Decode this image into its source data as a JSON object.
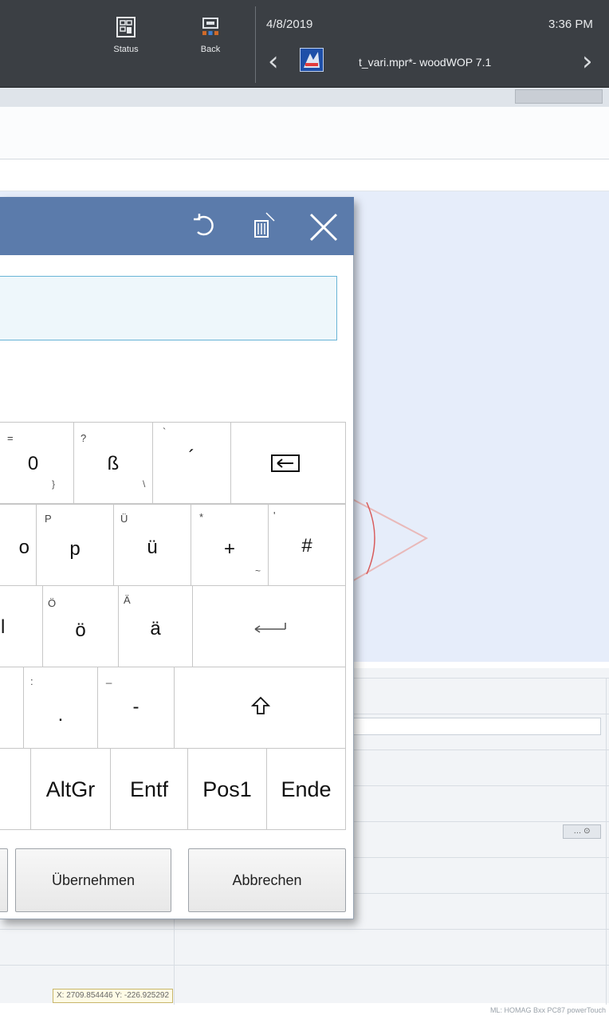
{
  "system_bar": {
    "status_label": "Status",
    "back_label": "Back",
    "date": "4/8/2019",
    "time": "3:36 PM",
    "app_title": "t_vari.mpr*- woodWOP 7.1"
  },
  "keyboard": {
    "rows": [
      [
        {
          "main": "0",
          "sup": "=",
          "sub": "}"
        },
        {
          "main": "ß",
          "sup": "?",
          "sub": "\\"
        },
        {
          "main": "´",
          "sup": "`",
          "sub": ""
        },
        {
          "main": "",
          "sup": "",
          "sub": "",
          "icon": "backspace-icon"
        }
      ],
      [
        {
          "main": "o",
          "sup": "",
          "sub": ""
        },
        {
          "main": "p",
          "sup": "P",
          "sub": ""
        },
        {
          "main": "ü",
          "sup": "Ü",
          "sub": ""
        },
        {
          "main": "+",
          "sup": "*",
          "sub": "~"
        },
        {
          "main": "#",
          "sup": "'",
          "sub": ""
        }
      ],
      [
        {
          "main": "l",
          "sup": "",
          "sub": ""
        },
        {
          "main": "ö",
          "sup": "Ö",
          "sub": ""
        },
        {
          "main": "ä",
          "sup": "Ä",
          "sub": ""
        },
        {
          "main": "",
          "sup": "",
          "sub": "",
          "icon": "enter-icon"
        }
      ],
      [
        {
          "main": ".",
          "sup": ":",
          "sub": ""
        },
        {
          "main": "-",
          "sup": "_",
          "sub": ""
        },
        {
          "main": "",
          "sup": "",
          "sub": "",
          "icon": "shift-icon"
        }
      ],
      [
        {
          "main": "AltGr"
        },
        {
          "main": "Entf"
        },
        {
          "main": "Pos1"
        },
        {
          "main": "Ende"
        }
      ]
    ]
  },
  "dialog": {
    "apply_label": "Übernehmen",
    "cancel_label": "Abbrechen"
  },
  "status": {
    "coordinates": "X: 2709.854446 Y: -226.925292",
    "machine": "ML: HOMAG Bxx PC87 powerTouch"
  },
  "colors": {
    "title_bar": "#5b7bab",
    "top_bar": "#3b3f44",
    "input_border": "#69b4d6",
    "canvas": "#e6edfa"
  }
}
